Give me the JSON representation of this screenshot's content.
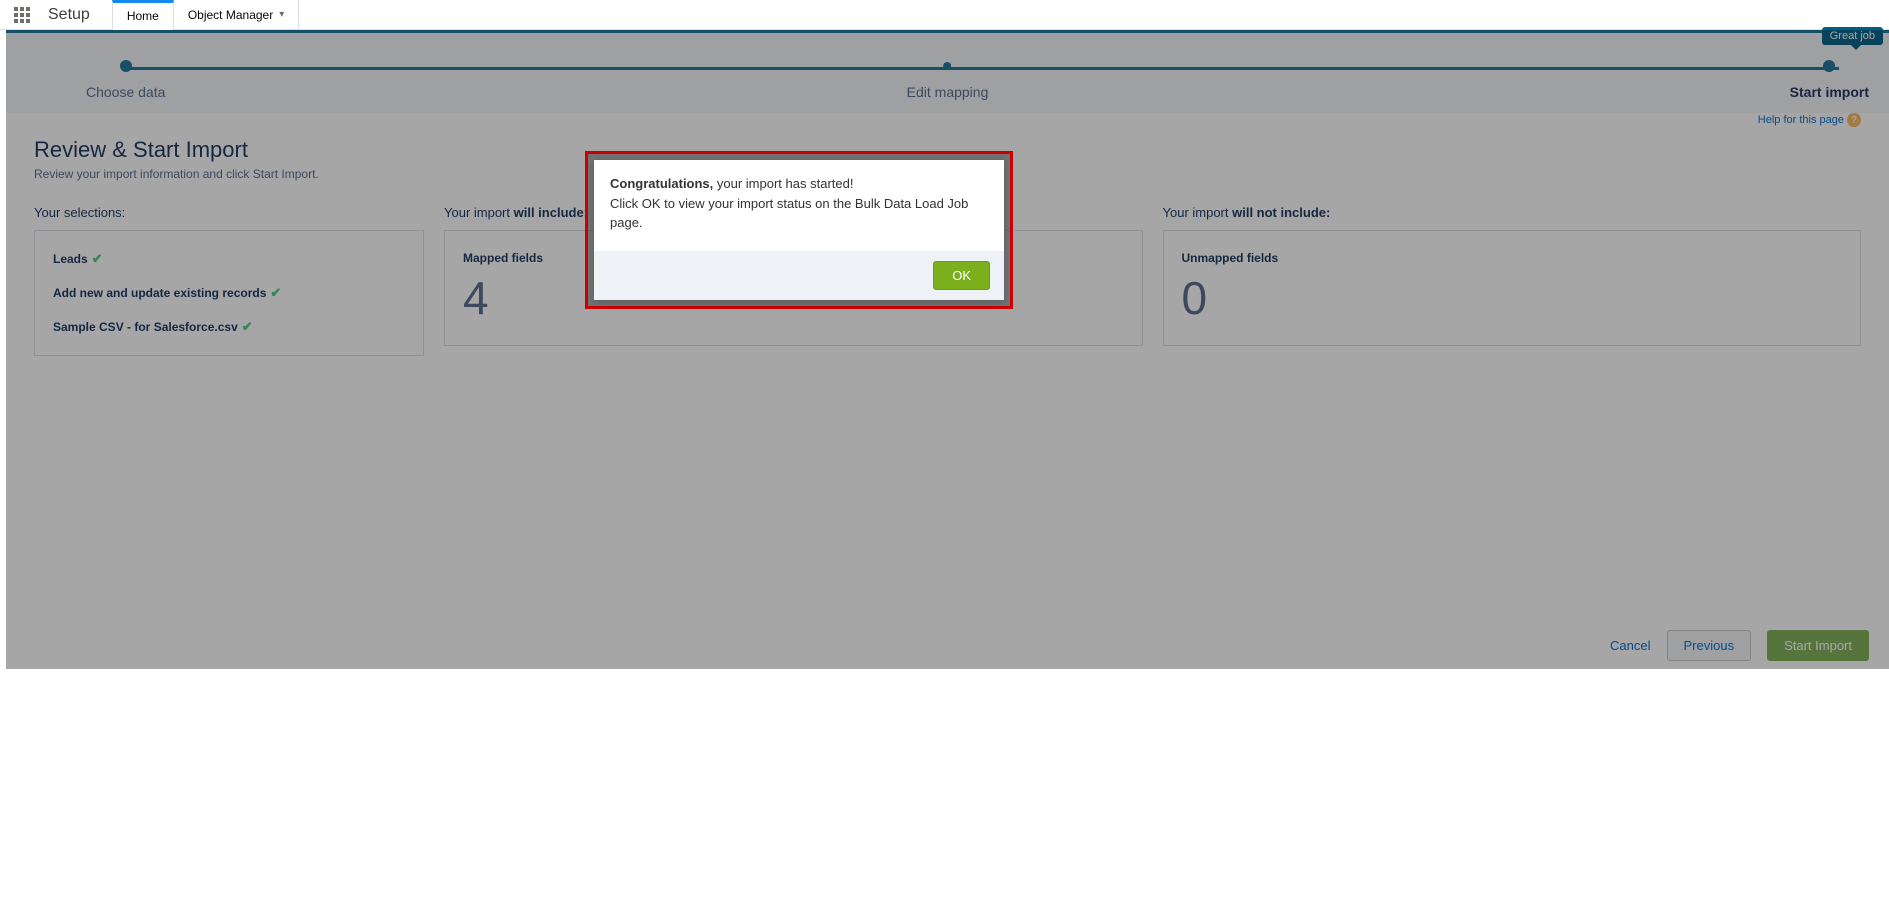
{
  "topbar": {
    "title": "Setup",
    "tabs": [
      {
        "label": "Home",
        "active": true
      },
      {
        "label": "Object Manager",
        "active": false,
        "has_chevron": true
      }
    ]
  },
  "wizard": {
    "callout": "Great job",
    "steps": [
      {
        "label": "Choose data"
      },
      {
        "label": "Edit mapping"
      },
      {
        "label": "Start import",
        "active": true
      }
    ]
  },
  "page": {
    "title": "Review & Start Import",
    "subtitle": "Review your import information and click Start Import.",
    "help_label": "Help for this page"
  },
  "columns": {
    "selections": {
      "heading": "Your selections:",
      "items": [
        "Leads",
        "Add new and update existing records",
        "Sample CSV - for Salesforce.csv"
      ]
    },
    "include": {
      "heading_prefix": "Your import ",
      "heading_bold": "will include:",
      "metric_label": "Mapped fields",
      "metric_value": "4"
    },
    "exclude": {
      "heading_prefix": "Your import ",
      "heading_bold": "will not include:",
      "metric_label": "Unmapped fields",
      "metric_value": "0"
    }
  },
  "footer": {
    "cancel": "Cancel",
    "previous": "Previous",
    "start": "Start Import"
  },
  "modal": {
    "congrats_label": "Congratulations,",
    "line1_rest": " your import has started!",
    "line2": "Click OK to view your import status on the Bulk Data Load Job page.",
    "ok_label": "OK"
  }
}
